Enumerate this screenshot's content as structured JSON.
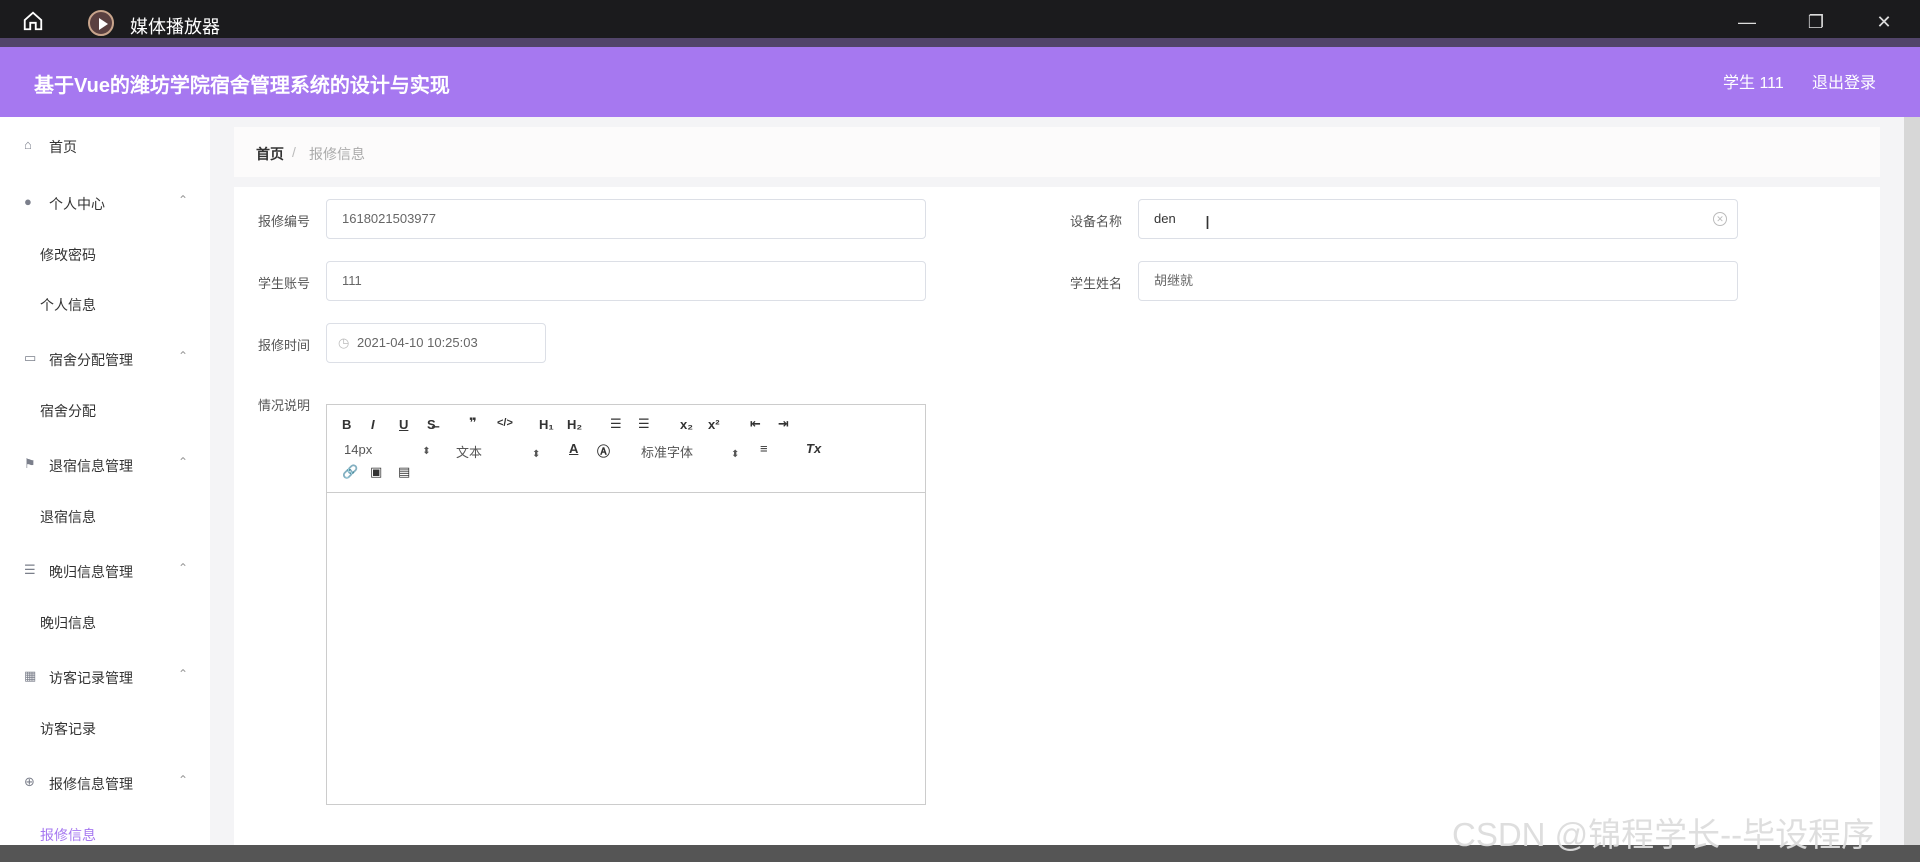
{
  "window": {
    "title": "媒体播放器"
  },
  "header": {
    "title": "基于Vue的潍坊学院宿舍管理系统的设计与实现",
    "user": "学生 111",
    "logout": "退出登录"
  },
  "sidebar": {
    "home": "首页",
    "groups": [
      {
        "label": "个人中心",
        "items": [
          "修改密码",
          "个人信息"
        ]
      },
      {
        "label": "宿舍分配管理",
        "items": [
          "宿舍分配"
        ]
      },
      {
        "label": "退宿信息管理",
        "items": [
          "退宿信息"
        ]
      },
      {
        "label": "晚归信息管理",
        "items": [
          "晚归信息"
        ]
      },
      {
        "label": "访客记录管理",
        "items": [
          "访客记录"
        ]
      },
      {
        "label": "报修信息管理",
        "items": [
          "报修信息"
        ]
      }
    ]
  },
  "breadcrumb": {
    "home": "首页",
    "separator": "/",
    "current": "报修信息"
  },
  "form": {
    "repair_no": {
      "label": "报修编号",
      "value": "1618021503977"
    },
    "device_name": {
      "label": "设备名称",
      "value": "den"
    },
    "student_account": {
      "label": "学生账号",
      "value": "111"
    },
    "student_name": {
      "label": "学生姓名",
      "value": "胡继就"
    },
    "repair_time": {
      "label": "报修时间",
      "value": "2021-04-10 10:25:03"
    },
    "description": {
      "label": "情况说明",
      "font_size": "14px",
      "text_style": "文本",
      "font_family": "标准字体"
    }
  },
  "watermark": "CSDN @锦程学长--毕设程序",
  "colors": {
    "accent": "#a678f0",
    "titlebar": "#1b1b1d"
  }
}
